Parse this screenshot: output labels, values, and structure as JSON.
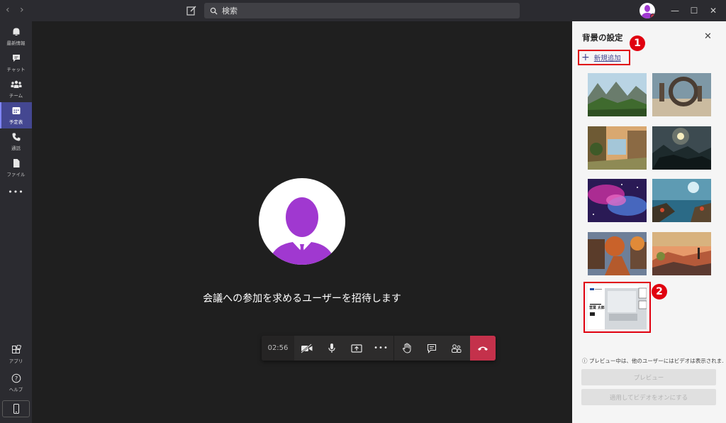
{
  "header": {
    "search_placeholder": "検索",
    "back_icon": "chevron-left-icon",
    "forward_icon": "chevron-right-icon",
    "minimize": "—",
    "maximize": "☐",
    "close": "✕"
  },
  "rail": {
    "items": [
      {
        "label": "最新情報",
        "icon": "bell-icon"
      },
      {
        "label": "チャット",
        "icon": "chat-icon"
      },
      {
        "label": "チーム",
        "icon": "teams-icon"
      },
      {
        "label": "予定表",
        "icon": "calendar-icon",
        "active": true
      },
      {
        "label": "通話",
        "icon": "phone-icon"
      },
      {
        "label": "ファイル",
        "icon": "file-icon"
      },
      {
        "label": "•••",
        "icon": "more-icon"
      }
    ],
    "bottom": [
      {
        "label": "アプリ",
        "icon": "apps-icon"
      },
      {
        "label": "ヘルプ",
        "icon": "help-icon"
      }
    ]
  },
  "meeting": {
    "invite_text": "会議への参加を求めるユーザーを招待します",
    "timer": "02:56",
    "more": "•••"
  },
  "panel": {
    "title": "背景の設定",
    "close": "✕",
    "add_new": "新規追加",
    "add_icon": "+",
    "badge1": "1",
    "badge2": "2",
    "preview_note": "ⓘ プレビュー中は、他のユーザーにはビデオは表示されま...",
    "preview_button": "プレビュー",
    "apply_button": "適用してビデオをオンにする",
    "custom_thumb_name": "営業 太郎"
  },
  "colors": {
    "accent": "#444791",
    "hangup": "#c4314b",
    "highlight": "#e0000f",
    "avatar_purple": "#a038d0"
  }
}
